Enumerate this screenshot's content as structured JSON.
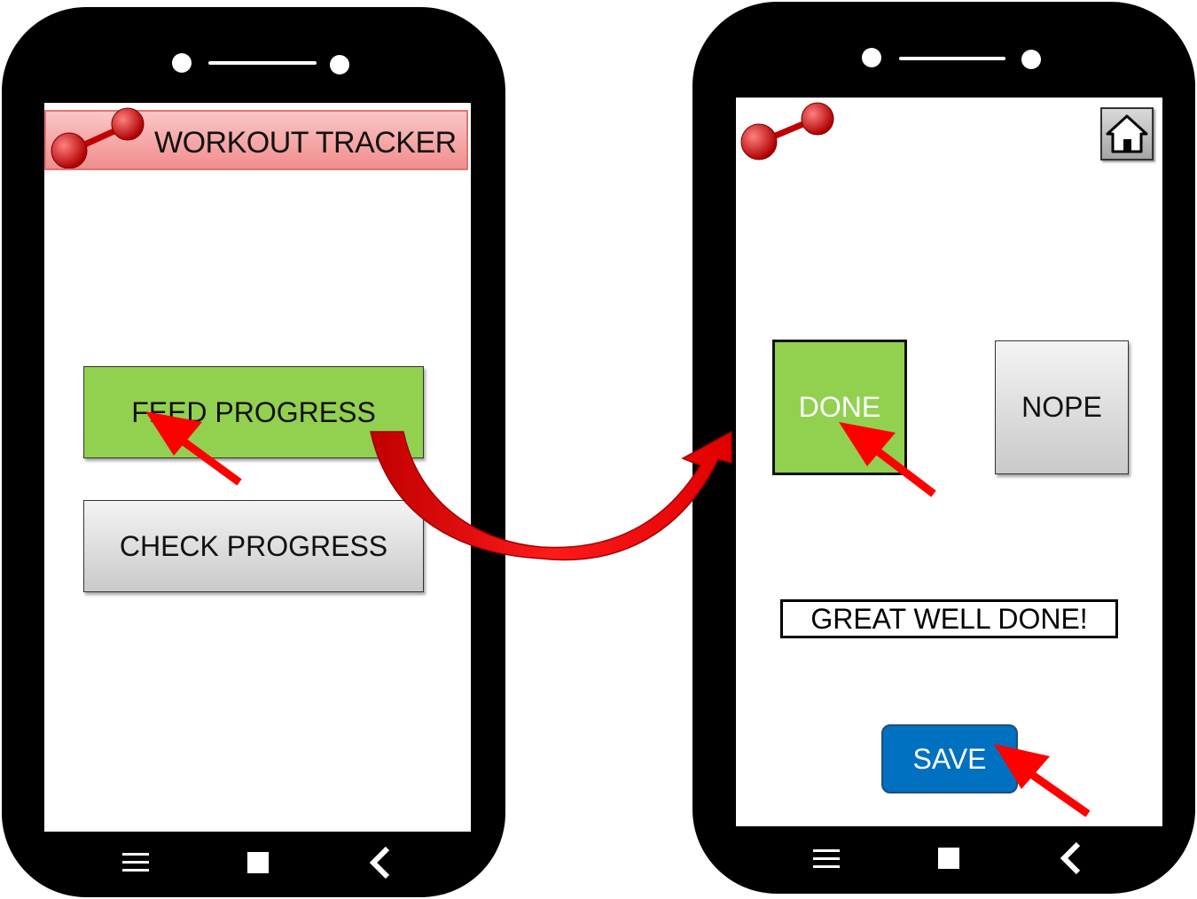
{
  "left_screen": {
    "title": "WORKOUT TRACKER",
    "logo_icon": "dumbbell-icon",
    "buttons": {
      "feed_progress": "FEED PROGRESS",
      "check_progress": "CHECK PROGRESS"
    }
  },
  "right_screen": {
    "logo_icon": "dumbbell-icon",
    "home_icon": "home-icon",
    "buttons": {
      "done": "DONE",
      "nope": "NOPE",
      "save": "SAVE"
    },
    "message": "GREAT WELL DONE!"
  },
  "nav_bar": {
    "menu_icon": "menu-icon",
    "home_icon": "square-home-icon",
    "back_icon": "back-chevron-icon"
  },
  "colors": {
    "phone_body": "#000000",
    "title_bar_bg": "#f4aaaa",
    "primary_green": "#92d050",
    "save_blue": "#0070c0",
    "annotation_red": "#ff0000"
  }
}
